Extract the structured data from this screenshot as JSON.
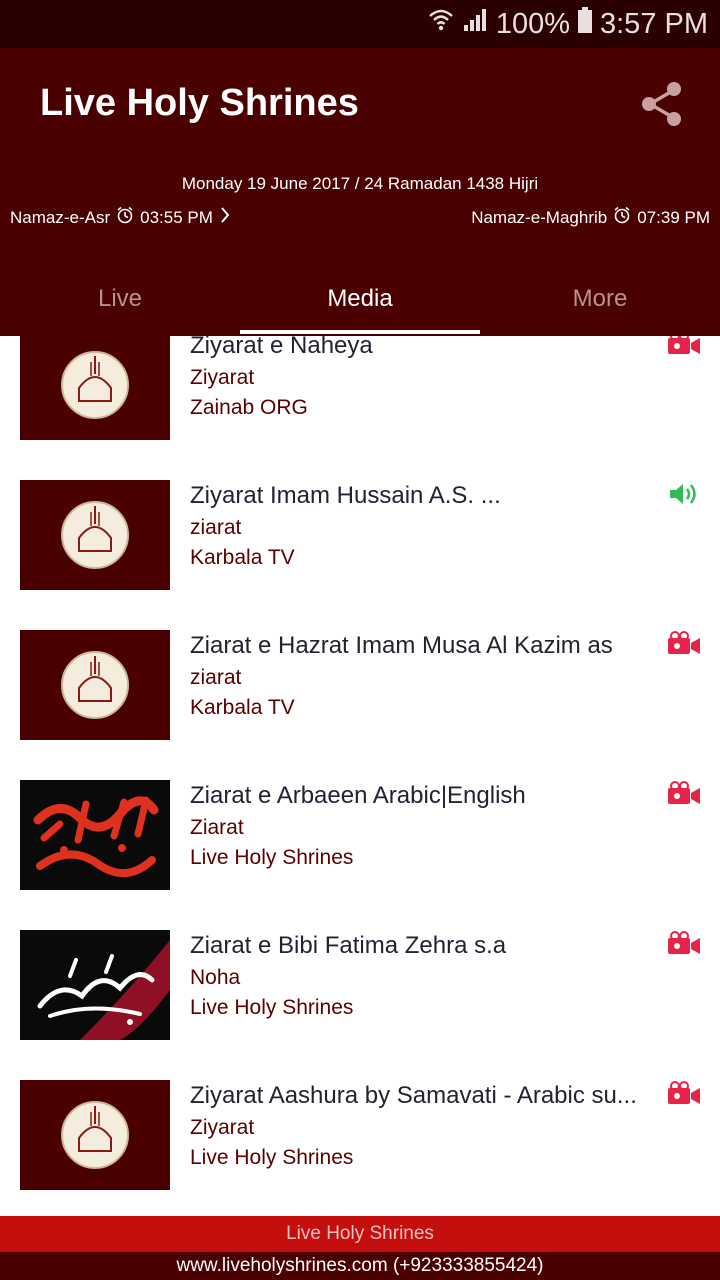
{
  "status_bar": {
    "battery": "100%",
    "time": "3:57 PM"
  },
  "header": {
    "title": "Live Holy Shrines",
    "share_icon": "share-icon",
    "date_line": "Monday 19 June 2017 / 24 Ramadan 1438 Hijri",
    "current_prayer": {
      "name": "Namaz-e-Asr",
      "time": "03:55 PM"
    },
    "next_prayer": {
      "name": "Namaz-e-Maghrib",
      "time": "07:39 PM"
    }
  },
  "tabs": [
    {
      "label": "Live",
      "active": false
    },
    {
      "label": "Media",
      "active": true
    },
    {
      "label": "More",
      "active": false
    }
  ],
  "media_items": [
    {
      "title": "Ziyarat e Naheya",
      "category": "Ziyarat",
      "source": "Zainab ORG",
      "type": "video",
      "thumb": "shrine-logo"
    },
    {
      "title": "Ziyarat Imam Hussain A.S.  ...",
      "category": "ziarat",
      "source": "Karbala TV",
      "type": "audio",
      "thumb": "shrine-logo"
    },
    {
      "title": "Ziarat e Hazrat Imam Musa Al Kazim as",
      "category": "ziarat",
      "source": "Karbala TV",
      "type": "video",
      "thumb": "shrine-logo"
    },
    {
      "title": "Ziarat e Arbaeen Arabic|English",
      "category": "Ziarat",
      "source": "Live Holy Shrines",
      "type": "video",
      "thumb": "arabic-calligraphy"
    },
    {
      "title": "Ziarat e Bibi Fatima Zehra s.a",
      "category": "Noha",
      "source": "Live Holy Shrines",
      "type": "video",
      "thumb": "fatima-calligraphy"
    },
    {
      "title": "Ziyarat Aashura by Samavati - Arabic su...",
      "category": "Ziyarat",
      "source": "Live Holy Shrines",
      "type": "video",
      "thumb": "shrine-logo"
    }
  ],
  "footer": {
    "brand": "Live Holy Shrines",
    "contact": "www.liveholyshrines.com (+923333855424)"
  },
  "colors": {
    "appbar": "#4a0000",
    "statusbar": "#2a0000",
    "footer_red": "#c50e0e",
    "video_icon": "#e8234a",
    "audio_icon": "#2ebd59"
  }
}
